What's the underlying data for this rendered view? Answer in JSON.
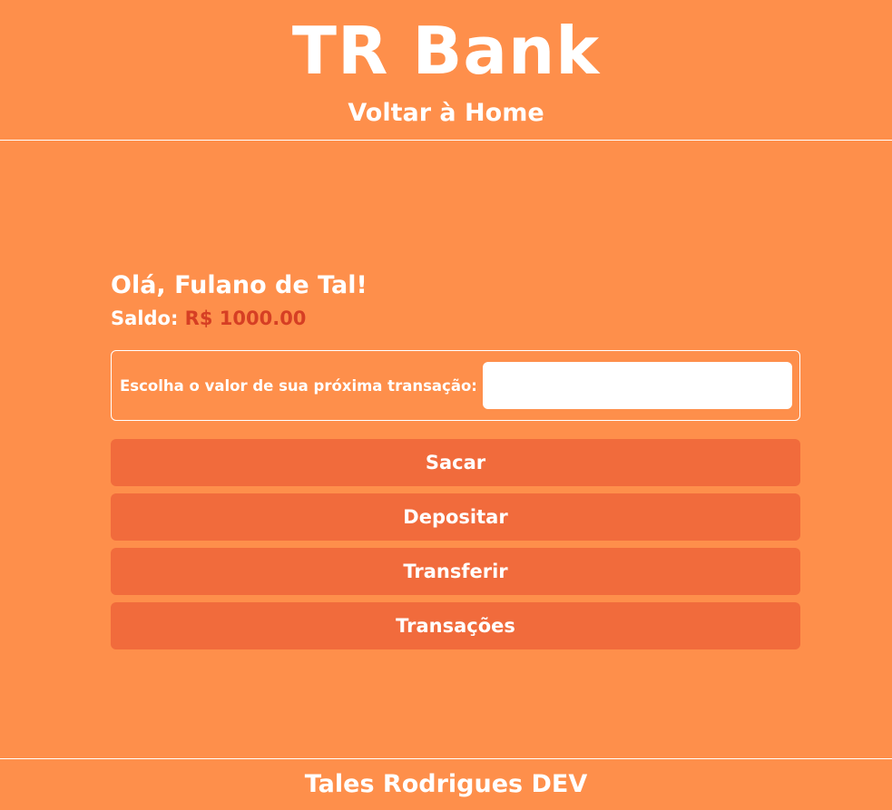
{
  "header": {
    "brand": "TR Bank",
    "home_link": "Voltar à Home"
  },
  "account": {
    "greeting": "Olá, Fulano de Tal!",
    "balance_label": "Saldo:",
    "balance_value": "R$ 1000.00"
  },
  "transaction": {
    "label": "Escolha o valor de sua próxima transação:",
    "value": "",
    "placeholder": ""
  },
  "actions": {
    "withdraw": "Sacar",
    "deposit": "Depositar",
    "transfer": "Transferir",
    "transactions": "Transações"
  },
  "footer": {
    "text": "Tales Rodrigues DEV"
  },
  "colors": {
    "background": "#fe8f4b",
    "button": "#f16b3c",
    "balance_value": "#d63f24",
    "text": "#ffffff"
  }
}
